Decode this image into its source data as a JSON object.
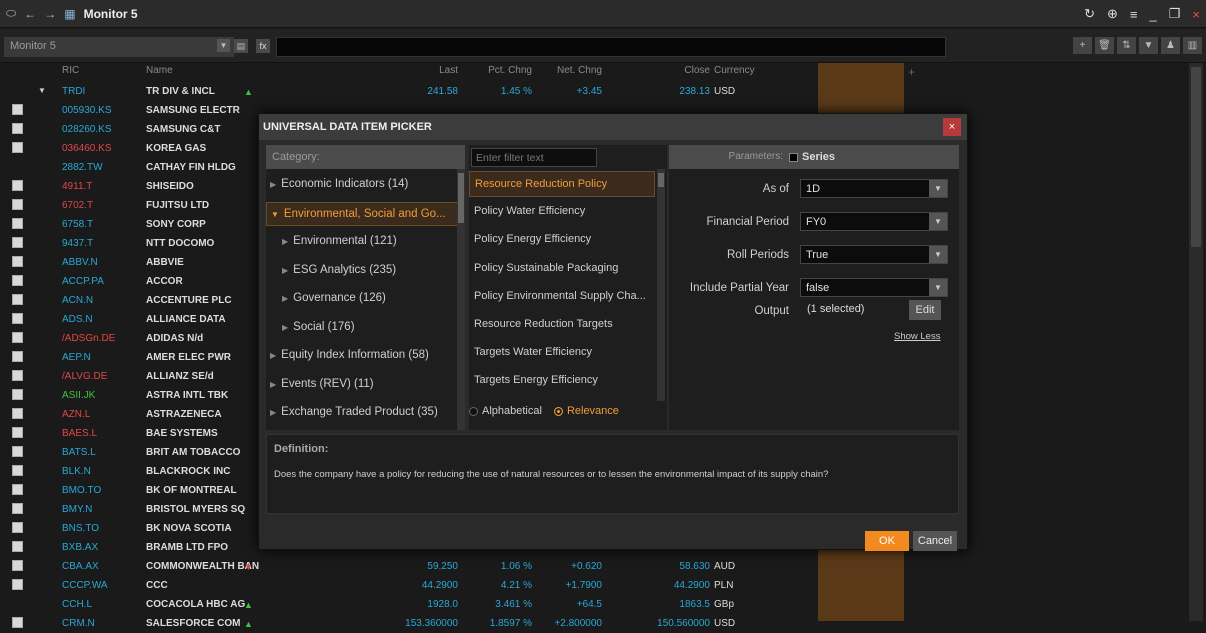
{
  "window": {
    "title": "Monitor 5"
  },
  "toolbar": {
    "monitor_name": "Monitor 5",
    "fx_label": "fx"
  },
  "grid": {
    "headers": {
      "ric": "RIC",
      "name": "Name",
      "last": "Last",
      "pct": "Pct. Chng",
      "net": "Net. Chng",
      "close": "Close",
      "currency": "Currency"
    },
    "rows": [
      {
        "ric": "TRDI",
        "name": "TR DIV & INCL",
        "last": "241.58",
        "pct": "1.45 %",
        "net": "+3.45",
        "close": "238.13",
        "currency": "USD",
        "ric_color": "#2aa8d8",
        "dir": "up",
        "expand": "▼",
        "icon": false
      },
      {
        "ric": "005930.KS",
        "name": "SAMSUNG ELECTR",
        "ric_color": "#2aa8d8",
        "icon": true
      },
      {
        "ric": "028260.KS",
        "name": "SAMSUNG C&T",
        "ric_color": "#2aa8d8",
        "icon": true
      },
      {
        "ric": "036460.KS",
        "name": "KOREA GAS",
        "ric_color": "#e04848",
        "icon": true
      },
      {
        "ric": "2882.TW",
        "name": "CATHAY FIN HLDG",
        "ric_color": "#2aa8d8",
        "icon": false
      },
      {
        "ric": "4911.T",
        "name": "SHISEIDO",
        "ric_color": "#e04848",
        "icon": true
      },
      {
        "ric": "6702.T",
        "name": "FUJITSU LTD",
        "ric_color": "#e04848",
        "icon": true
      },
      {
        "ric": "6758.T",
        "name": "SONY CORP",
        "ric_color": "#2aa8d8",
        "icon": true
      },
      {
        "ric": "9437.T",
        "name": "NTT DOCOMO",
        "ric_color": "#2aa8d8",
        "icon": true
      },
      {
        "ric": "ABBV.N",
        "name": "ABBVIE",
        "ric_color": "#2aa8d8",
        "icon": true
      },
      {
        "ric": "ACCP.PA",
        "name": "ACCOR",
        "ric_color": "#2aa8d8",
        "icon": true
      },
      {
        "ric": "ACN.N",
        "name": "ACCENTURE PLC",
        "ric_color": "#2aa8d8",
        "icon": true
      },
      {
        "ric": "ADS.N",
        "name": "ALLIANCE DATA",
        "ric_color": "#2aa8d8",
        "icon": true
      },
      {
        "ric": "/ADSGn.DE",
        "name": "ADIDAS N/d",
        "ric_color": "#e04848",
        "icon": true
      },
      {
        "ric": "AEP.N",
        "name": "AMER ELEC PWR",
        "ric_color": "#2aa8d8",
        "icon": true
      },
      {
        "ric": "/ALVG.DE",
        "name": "ALLIANZ SE/d",
        "ric_color": "#e04848",
        "icon": true
      },
      {
        "ric": "ASII.JK",
        "name": "ASTRA INTL TBK",
        "ric_color": "#3fc43f",
        "icon": true
      },
      {
        "ric": "AZN.L",
        "name": "ASTRAZENECA",
        "ric_color": "#e04848",
        "icon": true
      },
      {
        "ric": "BAES.L",
        "name": "BAE SYSTEMS",
        "ric_color": "#e04848",
        "icon": true
      },
      {
        "ric": "BATS.L",
        "name": "BRIT AM TOBACCO",
        "ric_color": "#2aa8d8",
        "icon": true
      },
      {
        "ric": "BLK.N",
        "name": "BLACKROCK INC",
        "ric_color": "#2aa8d8",
        "icon": true
      },
      {
        "ric": "BMO.TO",
        "name": "BK OF MONTREAL",
        "ric_color": "#2aa8d8",
        "icon": true
      },
      {
        "ric": "BMY.N",
        "name": "BRISTOL MYERS SQ",
        "ric_color": "#2aa8d8",
        "icon": true
      },
      {
        "ric": "BNS.TO",
        "name": "BK NOVA SCOTIA",
        "ric_color": "#2aa8d8",
        "icon": true
      },
      {
        "ric": "BXB.AX",
        "name": "BRAMB LTD FPO",
        "ric_color": "#2aa8d8",
        "icon": true
      },
      {
        "ric": "CBA.AX",
        "name": "COMMONWEALTH BAN",
        "last": "59.250",
        "pct": "1.06 %",
        "net": "+0.620",
        "close": "58.630",
        "currency": "AUD",
        "ric_color": "#2aa8d8",
        "dir": "down",
        "icon": true
      },
      {
        "ric": "CCCP.WA",
        "name": "CCC",
        "last": "44.2900",
        "pct": "4.21 %",
        "net": "+1.7900",
        "close": "44.2900",
        "currency": "PLN",
        "ric_color": "#2aa8d8",
        "icon": true
      },
      {
        "ric": "CCH.L",
        "name": "COCACOLA HBC AG",
        "last": "1928.0",
        "pct": "3.461 %",
        "net": "+64.5",
        "close": "1863.5",
        "currency": "GBp",
        "ric_color": "#2aa8d8",
        "dir": "up",
        "icon": false
      },
      {
        "ric": "CRM.N",
        "name": "SALESFORCE COM",
        "last": "153.360000",
        "pct": "1.8597 %",
        "net": "+2.800000",
        "close": "150.560000",
        "currency": "USD",
        "ric_color": "#2aa8d8",
        "dir": "up",
        "icon": true
      }
    ]
  },
  "dialog": {
    "title": "UNIVERSAL DATA ITEM PICKER",
    "close": "×",
    "category_header": "Category:",
    "categories": [
      {
        "label": "Economic Indicators (14)",
        "level": 0,
        "arrow": "▶",
        "selected": false
      },
      {
        "label": "Environmental, Social and Go...",
        "level": 0,
        "arrow": "▼",
        "selected": true
      },
      {
        "label": "Environmental (121)",
        "level": 1,
        "arrow": "▶",
        "selected": false
      },
      {
        "label": "ESG Analytics (235)",
        "level": 1,
        "arrow": "▶",
        "selected": false
      },
      {
        "label": "Governance (126)",
        "level": 1,
        "arrow": "▶",
        "selected": false
      },
      {
        "label": "Social (176)",
        "level": 1,
        "arrow": "▶",
        "selected": false
      },
      {
        "label": "Equity Index Information (58)",
        "level": 0,
        "arrow": "▶",
        "selected": false
      },
      {
        "label": "Events (REV) (11)",
        "level": 0,
        "arrow": "▶",
        "selected": false
      },
      {
        "label": "Exchange Traded Product (35)",
        "level": 0,
        "arrow": "▶",
        "selected": false
      }
    ],
    "filter_placeholder": "Enter filter text",
    "items": [
      {
        "label": "Resource Reduction Policy",
        "selected": true
      },
      {
        "label": "Policy Water Efficiency",
        "selected": false
      },
      {
        "label": "Policy Energy Efficiency",
        "selected": false
      },
      {
        "label": "Policy Sustainable Packaging",
        "selected": false
      },
      {
        "label": "Policy Environmental Supply Cha...",
        "selected": false
      },
      {
        "label": "Resource Reduction Targets",
        "selected": false
      },
      {
        "label": "Targets Water Efficiency",
        "selected": false
      },
      {
        "label": "Targets Energy Efficiency",
        "selected": false
      }
    ],
    "sort_alpha": "Alphabetical",
    "sort_relevance": "Relevance",
    "parameters_label": "Parameters:",
    "series_label": "Series",
    "params": [
      {
        "label": "As of",
        "value": "1D"
      },
      {
        "label": "Financial Period",
        "value": "FY0"
      },
      {
        "label": "Roll Periods",
        "value": "True"
      },
      {
        "label": "Include Partial Year",
        "value": "false"
      }
    ],
    "output_label": "Output",
    "output_value": "(1 selected)",
    "edit_label": "Edit",
    "show_less": "Show Less",
    "definition_title": "Definition:",
    "definition_text": "Does the company have a policy for reducing the use of natural resources or to lessen the environmental impact of its supply chain?",
    "ok_label": "OK",
    "cancel_label": "Cancel"
  },
  "colors": {
    "accent": "#f39c3a",
    "up": "#3fc43f",
    "down": "#e04848",
    "ric_blue": "#2aa8d8",
    "numbers": "#2aa8d8"
  }
}
